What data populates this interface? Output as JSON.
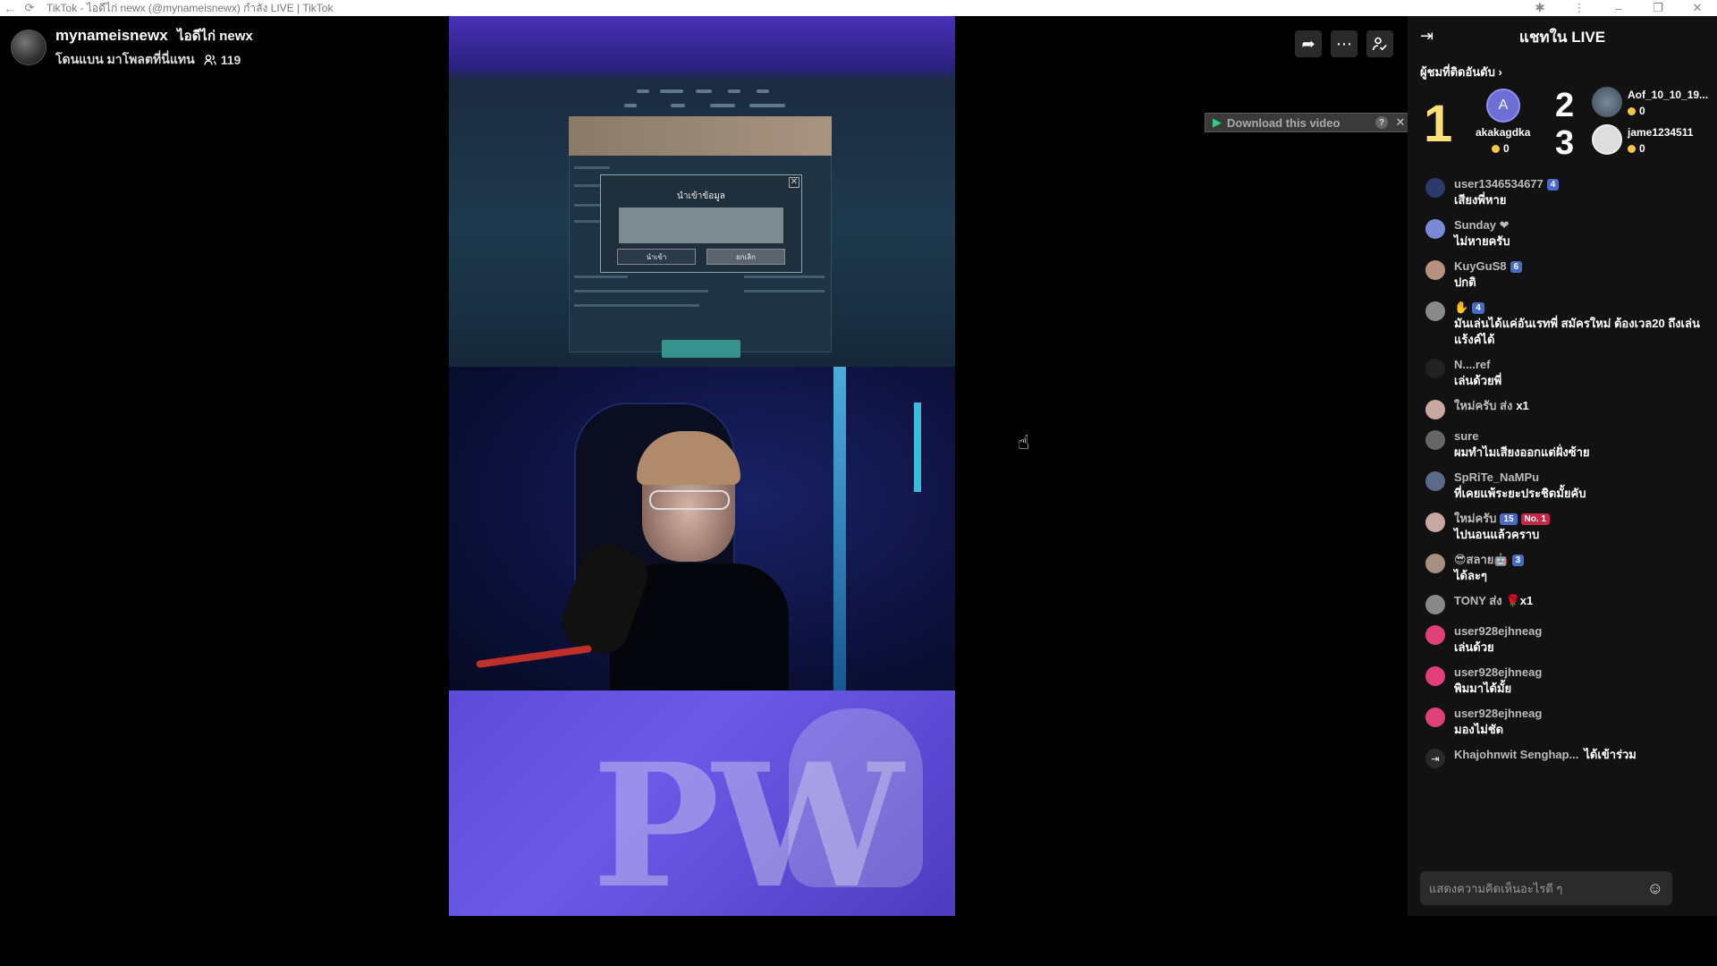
{
  "browser": {
    "tab_title": "TikTok - ไอดีไก่ newx (@mynameisnewx) กำลัง LIVE | TikTok"
  },
  "host": {
    "username": "mynameisnewx",
    "nickname": "ไอดีไก่ newx",
    "subtitle": "โดนแบน มาโพลตที่นี่แทน",
    "viewers": "119"
  },
  "stream_overlay": {
    "dialog_title": "นำเข้าข้อมูล",
    "dialog_ok": "นำเข้า",
    "dialog_cancel": "ยกเลิก",
    "bottom_graphic": "PW"
  },
  "download_pill": {
    "label": "Download this video",
    "help": "?",
    "close": "✕"
  },
  "chat": {
    "title": "แชทใน LIVE",
    "ranking_label": "ผู้ชมที่ติดอันดับ ›",
    "top_viewers": [
      {
        "rank": "1",
        "avatar_letter": "A",
        "name": "akakagdka",
        "coins": "0"
      },
      {
        "rank": "2",
        "name": "Aof_10_10_19...",
        "coins": "0"
      },
      {
        "rank": "3",
        "name": "jame1234511",
        "coins": "0"
      }
    ],
    "messages": [
      {
        "user": "user1346534677",
        "badge": "4",
        "text": "เสียงพี่หาย",
        "color": "#2a3a6a"
      },
      {
        "user": "Sunday ❤",
        "badge": "",
        "text": "ไม่หายครับ",
        "color": "#7a8ad8"
      },
      {
        "user": "KuyGuS8",
        "badge": "6",
        "text": "ปกติ",
        "color": "#b89080"
      },
      {
        "user": "✋",
        "badge": "4",
        "text": "มันเล่นได้แค่อันเรทพี่ สมัครใหม่ ต้องเวล20 ถึงเล่นแร้งค์ได้",
        "color": "#8a8a8a"
      },
      {
        "user": "N....ref",
        "badge": "",
        "text": "เล่นด้วยพี่",
        "color": "#222"
      },
      {
        "user": "ใหม่ครับ ส่ง",
        "badge": "",
        "text": "x1",
        "color": "#c8a8a0",
        "gift": true
      },
      {
        "user": "sure",
        "badge": "",
        "text": "ผมทำไมเสียงออกแต่ฝั่งซ้าย",
        "color": "#666"
      },
      {
        "user": "SpRiTe_NaMPu",
        "badge": "",
        "text": "ที่เคยแพ้ระยะประชิดมั้ยคับ",
        "color": "#5a6a8a"
      },
      {
        "user": "ใหม่ครับ",
        "badge": "15",
        "badge2": "No. 1",
        "text": "ไปนอนแล้วคราบ",
        "color": "#c8a8a0"
      },
      {
        "user": "😎สลาย🤖",
        "badge": "3",
        "text": "ได้ละๆ",
        "color": "#a89080"
      },
      {
        "user": "TONY ส่ง",
        "badge": "",
        "text": "🌹x1",
        "color": "#888",
        "gift": true
      },
      {
        "user": "user928ejhneag",
        "badge": "",
        "text": "เล่นด้วย",
        "color": "#e0407a"
      },
      {
        "user": "user928ejhneag",
        "badge": "",
        "text": "พิมมาได้มั้ย",
        "color": "#e0407a"
      },
      {
        "user": "user928ejhneag",
        "badge": "",
        "text": "มองไม่ชัด",
        "color": "#e0407a"
      }
    ],
    "join_notice": {
      "user": "Khajohnwit Senghap...",
      "text": "ได้เข้าร่วม"
    },
    "input_placeholder": "แสดงความคิดเห็นอะไรดี ๆ"
  },
  "colors": {
    "accent_coin": "#f6c744",
    "badge_blue": "#4a6ac8",
    "badge_red": "#c82848"
  }
}
